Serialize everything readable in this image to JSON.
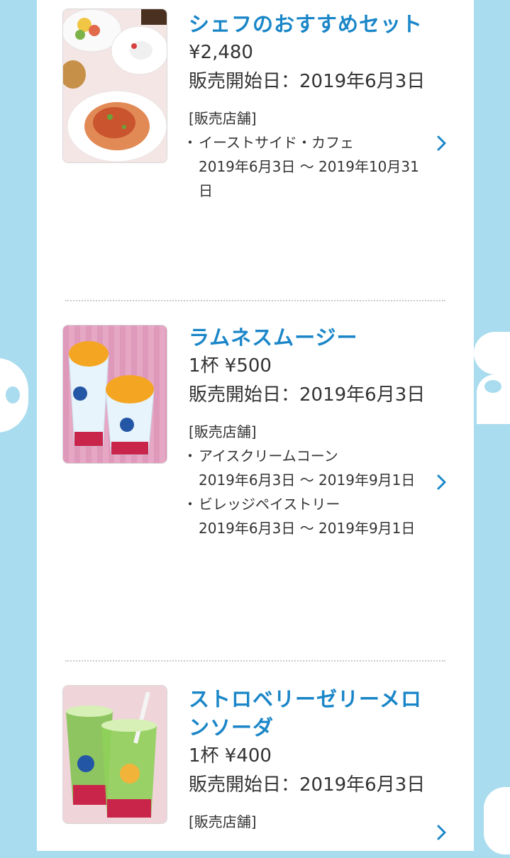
{
  "items": [
    {
      "title": "シェフのおすすめセット",
      "price": "¥2,480",
      "date": "販売開始日：2019年6月3日",
      "stores_label": "[販売店舗]",
      "stores": [
        {
          "name": "イーストサイド・カフェ",
          "period": "2019年6月3日 〜 2019年10月31日"
        }
      ]
    },
    {
      "title": "ラムネスムージー",
      "price": "1杯 ¥500",
      "date": "販売開始日：2019年6月3日",
      "stores_label": "[販売店舗]",
      "stores": [
        {
          "name": "アイスクリームコーン",
          "period": "2019年6月3日 〜 2019年9月1日"
        },
        {
          "name": "ビレッジペイストリー",
          "period": "2019年6月3日 〜 2019年9月1日"
        }
      ]
    },
    {
      "title": "ストロベリーゼリーメロンソーダ",
      "price": "1杯 ¥400",
      "date": "販売開始日：2019年6月3日",
      "stores_label": "[販売店舗]",
      "stores": []
    }
  ],
  "colors": {
    "accent": "#1a86c8",
    "background": "#a9dcee",
    "panel": "#ffffff"
  },
  "icons": {
    "detail_arrow": "chevron-right-icon"
  }
}
